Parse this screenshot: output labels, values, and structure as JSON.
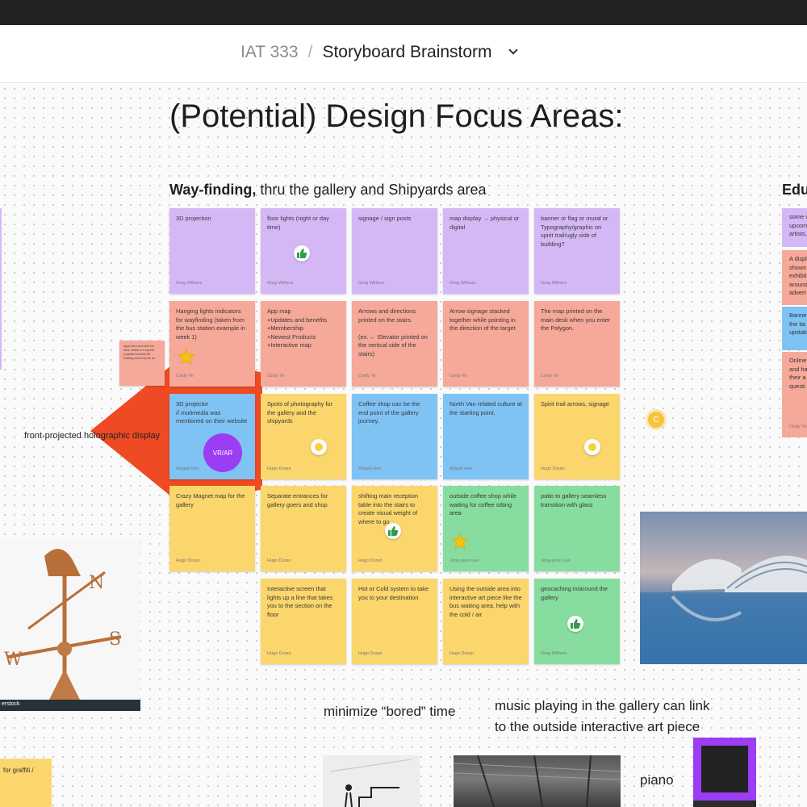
{
  "header": {
    "project": "IAT 333",
    "separator": "/",
    "file": "Storyboard Brainstorm"
  },
  "canvas": {
    "title": "(Potential) Design Focus Areas:",
    "section": {
      "bold": "Way-finding,",
      "rest": " thru the gallery and Shipyards area"
    },
    "edu_title": "Edu",
    "holographic_label": "front-projected holographic display",
    "vr_label": "VR/AR",
    "cursor_initial": "C",
    "bored_label": "minimize “bored” time",
    "music_line1": "music playing in the gallery can link",
    "music_line2": "to the outside interactive art piece",
    "piano_label": "piano",
    "weather_caption": "erstock",
    "bottom_note": "for graffiti /"
  },
  "small_note": {
    "text": "signs that come with the wind, similar to a symbol projected towards the building moved by the air"
  },
  "stickies": [
    {
      "text": "3D projection",
      "author": "Greg Withers",
      "color": "purple"
    },
    {
      "text": "floor lights (night or day time)",
      "author": "Greg Withers",
      "color": "purple",
      "icon": "thumbs-up"
    },
    {
      "text": "signage / sign posts",
      "author": "Greg Withers",
      "color": "purple"
    },
    {
      "text": "map display → physical or digital",
      "author": "Greg Withers",
      "color": "purple"
    },
    {
      "text": "banner or flag or mural or Typography/graphic on spirit trail/ugly side of building?",
      "author": "Greg Withers",
      "color": "purple"
    },
    {
      "text": "Hanging lights indicators for wayfinding (taken from the bus station example in week 1)",
      "author": "Cindy Ye",
      "color": "salmon",
      "icon": "star"
    },
    {
      "text": "App map\n+Updates and benefits\n+Membership\n+Newest Products\n+Interactive map",
      "author": "Cindy Ye",
      "color": "salmon"
    },
    {
      "text": "Arrows and directions printed on the stairs.\n\n(ex. ← Elevator printed on the vertical side of the stairs)",
      "author": "Cindy Ye",
      "color": "salmon"
    },
    {
      "text": "Arrow signage stacked together while pointing in the direction of the target",
      "author": "Cindy Ye",
      "color": "salmon"
    },
    {
      "text": "The map printed on the main desk when you enter the Polygon.",
      "author": "Cindy Ye",
      "color": "salmon"
    },
    {
      "text": "3D projector\n// mutimedia was mentioned on their website",
      "author": "Abigail Hoe",
      "color": "blue"
    },
    {
      "text": "Spots of photography for the gallery and the shipyards",
      "author": "Hugo Duran",
      "color": "yellow",
      "icon": "dot"
    },
    {
      "text": "Coffee shop can be the end point of the gallery journey.",
      "author": "Abigail Hoe",
      "color": "blue"
    },
    {
      "text": "North Van related culture at the starting point.",
      "author": "Abigail Hoe",
      "color": "blue"
    },
    {
      "text": "Spirit trail arrows, signage",
      "author": "Hugo Duran",
      "color": "yellow",
      "icon": "dot"
    },
    {
      "text": "Crazy Magnet map for the gallery",
      "author": "Hugo Duran",
      "color": "yellow"
    },
    {
      "text": "Separate entrances for gallery goers and shop",
      "author": "Hugo Duran",
      "color": "yellow"
    },
    {
      "text": "shifting main reception table into the stairs to create visual weight of where to go",
      "author": "Hugo Duran",
      "color": "yellow",
      "icon": "thumbs-up"
    },
    {
      "text": "outside coffee shop while waiting for coffee sitting area",
      "author": "Jang-yeon Lee",
      "color": "green",
      "icon": "star"
    },
    {
      "text": "patio to gallery seamless transition with glass",
      "author": "Jang-yeon Lee",
      "color": "green"
    },
    {
      "text": "Interactive screen that lights up a line that takes you to the section on the floor",
      "author": "Hugo Duran",
      "color": "yellow"
    },
    {
      "text": "Hot or Cold system to take you to your destination",
      "author": "Hugo Duran",
      "color": "yellow"
    },
    {
      "text": "Using the outside area into interactive art piece like the bus waiting area, help with the cold / air.",
      "author": "Hugo Duran",
      "color": "yellow"
    },
    {
      "text": "geocaching in/around the gallery",
      "author": "Greg Withers",
      "color": "green",
      "icon": "thumbs-up"
    }
  ],
  "edu": [
    {
      "text": "some v\nupcom\nartists,",
      "color": "#d4b8f6"
    },
    {
      "text": "A displ\nshows\nexhibit\naround\nadvert",
      "color": "#f6a899"
    },
    {
      "text": "Banne\nthe lat\nupstak",
      "color": "#7fc3f5"
    },
    {
      "text": "Online\nand ha\ntheir a\nquesti",
      "color": "#f6a899"
    }
  ],
  "edu_author": "Cindy Ye",
  "colors": {
    "purple": "#d4b8f6",
    "salmon": "#f6a899",
    "blue": "#7fc3f5",
    "yellow": "#fbd66c",
    "green": "#86dd9f",
    "accent_red": "#ee4a24",
    "vr_purple": "#9b3df2"
  }
}
